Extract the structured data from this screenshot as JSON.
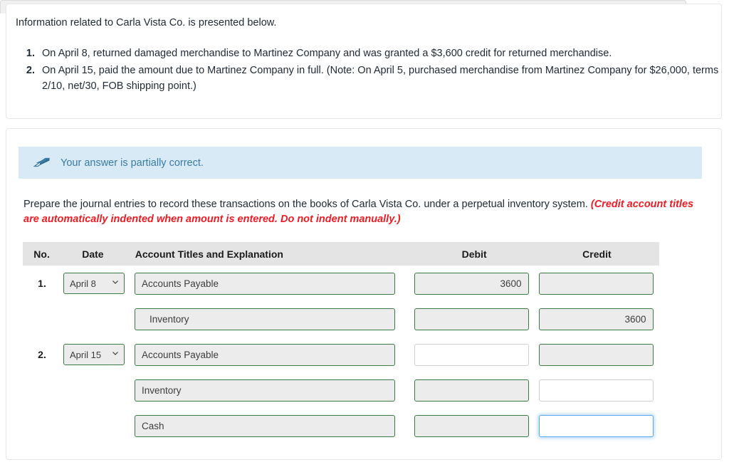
{
  "info": {
    "intro": "Information related to Carla Vista Co. is presented below.",
    "facts": [
      "On April 8, returned damaged merchandise to Martinez Company and was granted a $3,600 credit for returned merchandise.",
      "On April 15, paid the amount due to Martinez Company in full. (Note: On April 5, purchased merchandise from Martinez Company for $26,000, terms 2/10, net/30, FOB shipping point.)"
    ]
  },
  "feedback": {
    "icon": "eraser-icon",
    "message": "Your answer is partially correct.",
    "background_color": "#d7eaf5",
    "text_color": "#3a7ca5"
  },
  "instruction": {
    "main": "Prepare the journal entries to record these transactions on the books of Carla Vista Co. under a perpetual inventory system.",
    "hint": "(Credit account titles are automatically indented when amount is entered. Do not indent manually.)",
    "hint_color": "#ec1c24"
  },
  "table": {
    "headers": {
      "no": "No.",
      "date": "Date",
      "account": "Account Titles and Explanation",
      "debit": "Debit",
      "credit": "Credit"
    },
    "header_bg": "#e4e4e4",
    "field_border_graded": "#3c7a45",
    "field_bg_graded": "#ececec",
    "focus_border": "#5ba9f0",
    "rows": [
      {
        "no": "1.",
        "date": "April 8",
        "account": "Accounts Payable",
        "account_indented": false,
        "debit": "3600",
        "credit": "",
        "debit_state": "graded",
        "credit_state": "graded",
        "account_state": "graded",
        "date_state": "graded"
      },
      {
        "no": "",
        "date": "",
        "account": "Inventory",
        "account_indented": true,
        "debit": "",
        "credit": "3600",
        "debit_state": "graded",
        "credit_state": "graded",
        "account_state": "graded",
        "date_state": "none"
      },
      {
        "no": "2.",
        "date": "April 15",
        "account": "Accounts Payable",
        "account_indented": false,
        "debit": "",
        "credit": "",
        "debit_state": "open",
        "credit_state": "graded",
        "account_state": "graded",
        "date_state": "graded"
      },
      {
        "no": "",
        "date": "",
        "account": "Inventory",
        "account_indented": false,
        "debit": "",
        "credit": "",
        "debit_state": "graded",
        "credit_state": "open",
        "account_state": "graded",
        "date_state": "none"
      },
      {
        "no": "",
        "date": "",
        "account": "Cash",
        "account_indented": false,
        "debit": "",
        "credit": "",
        "debit_state": "graded",
        "credit_state": "focused",
        "account_state": "graded",
        "date_state": "none"
      }
    ]
  }
}
